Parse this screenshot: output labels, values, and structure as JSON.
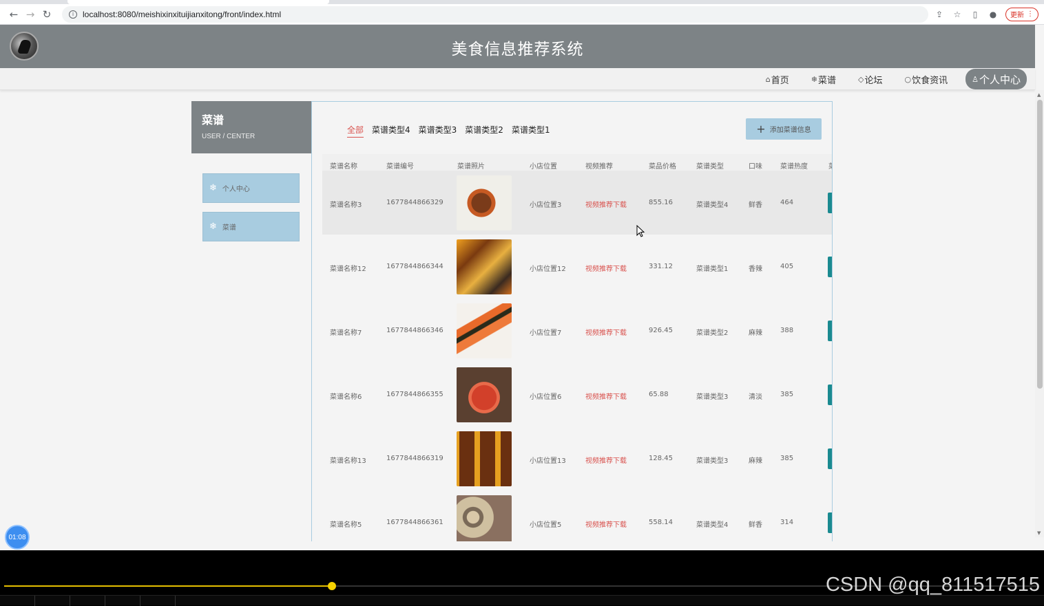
{
  "browser": {
    "url": "localhost:8080/meishixinxituijianxitong/front/index.html",
    "update_label": "更新"
  },
  "site": {
    "title": "美食信息推荐系统"
  },
  "nav": {
    "items": [
      {
        "icon": "home-icon",
        "glyph": "⌂",
        "label": "首页"
      },
      {
        "icon": "snowflake-icon",
        "glyph": "❄",
        "label": "菜谱"
      },
      {
        "icon": "tag-icon",
        "glyph": "◇",
        "label": "论坛"
      },
      {
        "icon": "circle-icon",
        "glyph": "○",
        "label": "饮食资讯"
      }
    ],
    "user_center": {
      "icon": "user-icon",
      "glyph": "♙",
      "label": "个人中心"
    }
  },
  "sidebar": {
    "title": "菜谱",
    "subtitle": "USER / CENTER",
    "items": [
      {
        "icon": "snowflake-icon",
        "label": "个人中心"
      },
      {
        "icon": "snowflake-icon",
        "label": "菜谱"
      }
    ]
  },
  "filters": [
    "全部",
    "菜谱类型4",
    "菜谱类型3",
    "菜谱类型2",
    "菜谱类型1"
  ],
  "add_button": {
    "label": "添加菜谱信息"
  },
  "table": {
    "headers": [
      "菜谱名称",
      "菜谱编号",
      "菜谱照片",
      "小店位置",
      "视频推荐",
      "菜品价格",
      "菜谱类型",
      "口味",
      "菜谱热度",
      "菜"
    ],
    "rows": [
      {
        "name": "菜谱名称3",
        "code": "1677844866329",
        "location": "小店位置3",
        "video": "视频推荐下载",
        "price": "855.16",
        "type": "菜谱类型4",
        "taste": "鲜香",
        "heat": "464"
      },
      {
        "name": "菜谱名称12",
        "code": "1677844866344",
        "location": "小店位置12",
        "video": "视频推荐下载",
        "price": "331.12",
        "type": "菜谱类型1",
        "taste": "香辣",
        "heat": "405"
      },
      {
        "name": "菜谱名称7",
        "code": "1677844866346",
        "location": "小店位置7",
        "video": "视频推荐下载",
        "price": "926.45",
        "type": "菜谱类型2",
        "taste": "麻辣",
        "heat": "388"
      },
      {
        "name": "菜谱名称6",
        "code": "1677844866355",
        "location": "小店位置6",
        "video": "视频推荐下载",
        "price": "65.88",
        "type": "菜谱类型3",
        "taste": "清淡",
        "heat": "385"
      },
      {
        "name": "菜谱名称13",
        "code": "1677844866319",
        "location": "小店位置13",
        "video": "视频推荐下载",
        "price": "128.45",
        "type": "菜谱类型3",
        "taste": "麻辣",
        "heat": "385"
      },
      {
        "name": "菜谱名称5",
        "code": "1677844866361",
        "location": "小店位置5",
        "video": "视频推荐下载",
        "price": "558.14",
        "type": "菜谱类型4",
        "taste": "鲜香",
        "heat": "314"
      }
    ]
  },
  "overlay": {
    "time": "01:08"
  },
  "player": {
    "progress": 0.317
  },
  "watermark": "CSDN @qq_811517515"
}
